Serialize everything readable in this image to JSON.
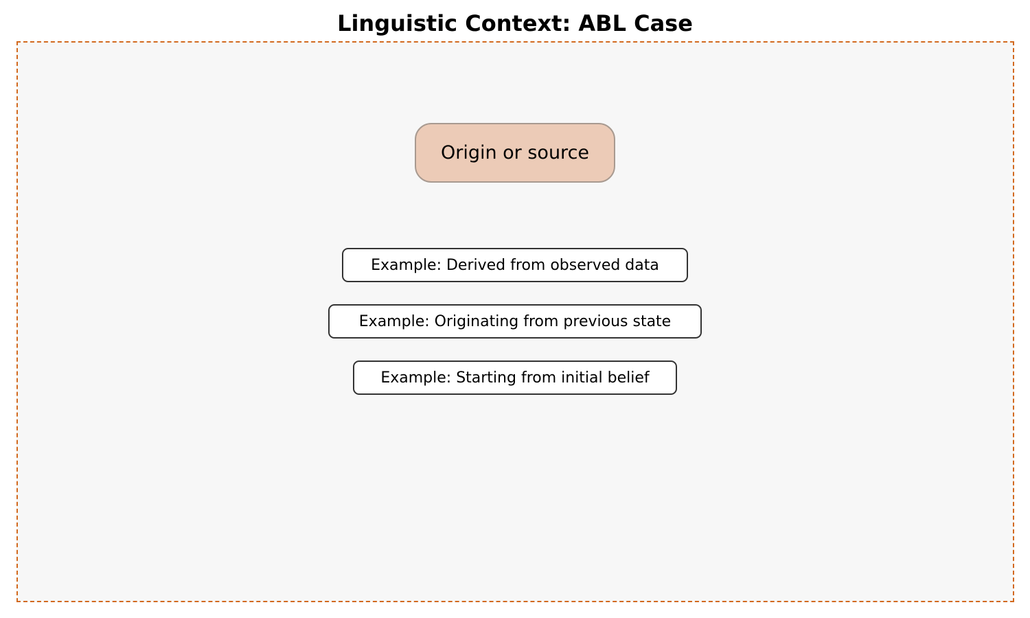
{
  "title": "Linguistic Context: ABL Case",
  "concept": {
    "label": "Origin or source",
    "fill_color": "#eccbb7"
  },
  "examples": [
    "Example: Derived from observed data",
    "Example: Originating from previous state",
    "Example: Starting from initial belief"
  ],
  "colors": {
    "panel_border": "#d2691e",
    "panel_background": "#f7f7f7"
  }
}
